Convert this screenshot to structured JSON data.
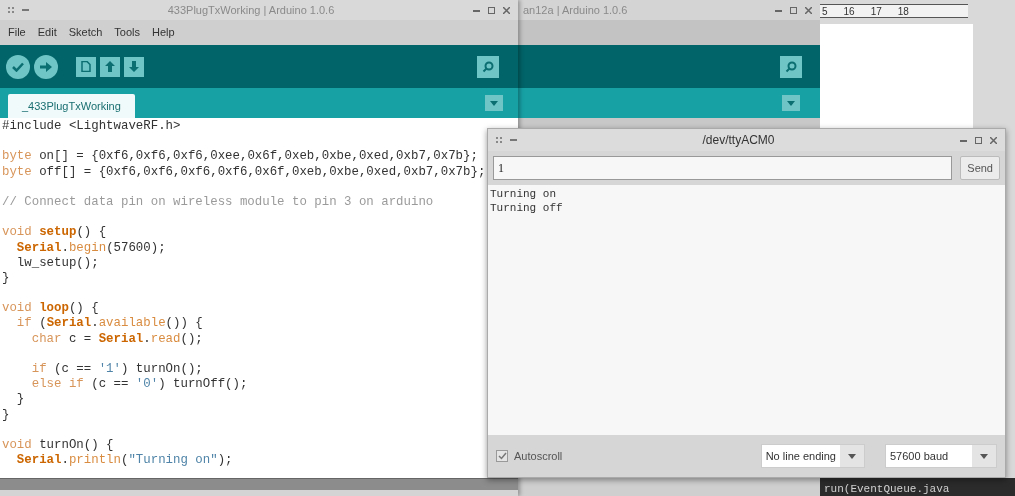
{
  "editor_window": {
    "title": "433PlugTxWorking | Arduino 1.0.6",
    "menu": [
      "File",
      "Edit",
      "Sketch",
      "Tools",
      "Help"
    ],
    "tabs": [
      {
        "label": "_433PlugTxWorking",
        "selected": true
      }
    ],
    "code": [
      {
        "kind": "code",
        "tokens": [
          {
            "kind": "plain",
            "text": "#include <LightwaveRF.h>"
          }
        ]
      },
      {
        "kind": "blank"
      },
      {
        "kind": "code",
        "tokens": [
          {
            "kind": "kw",
            "text": "byte"
          },
          {
            "kind": "plain",
            "text": " on[] = {0xf6,0xf6,0xf6,0xee,0x6f,0xeb,0xbe,0xed,0xb7,0x7b};"
          }
        ]
      },
      {
        "kind": "code",
        "tokens": [
          {
            "kind": "kw",
            "text": "byte"
          },
          {
            "kind": "plain",
            "text": " off[] = {0xf6,0xf6,0xf6,0xf6,0x6f,0xeb,0xbe,0xed,0xb7,0x7b};"
          }
        ]
      },
      {
        "kind": "blank"
      },
      {
        "kind": "code",
        "tokens": [
          {
            "kind": "comment",
            "text": "// Connect data pin on wireless module to pin 3 on arduino"
          }
        ]
      },
      {
        "kind": "blank"
      },
      {
        "kind": "code",
        "tokens": [
          {
            "kind": "kw",
            "text": "void"
          },
          {
            "kind": "fn",
            "text": " setup"
          },
          {
            "kind": "plain",
            "text": "() {"
          }
        ]
      },
      {
        "kind": "code",
        "tokens": [
          {
            "kind": "fn",
            "text": "  Serial"
          },
          {
            "kind": "plain",
            "text": "."
          },
          {
            "kind": "lib",
            "text": "begin"
          },
          {
            "kind": "plain",
            "text": "(57600);"
          }
        ]
      },
      {
        "kind": "code",
        "tokens": [
          {
            "kind": "plain",
            "text": "  lw_setup();"
          }
        ]
      },
      {
        "kind": "code",
        "tokens": [
          {
            "kind": "plain",
            "text": "}"
          }
        ]
      },
      {
        "kind": "blank"
      },
      {
        "kind": "code",
        "tokens": [
          {
            "kind": "kw",
            "text": "void"
          },
          {
            "kind": "fn",
            "text": " loop"
          },
          {
            "kind": "plain",
            "text": "() {"
          }
        ]
      },
      {
        "kind": "code",
        "tokens": [
          {
            "kind": "kw",
            "text": "  if"
          },
          {
            "kind": "plain",
            "text": " ("
          },
          {
            "kind": "fn",
            "text": "Serial"
          },
          {
            "kind": "plain",
            "text": "."
          },
          {
            "kind": "lib",
            "text": "available"
          },
          {
            "kind": "plain",
            "text": "()) {"
          }
        ]
      },
      {
        "kind": "code",
        "tokens": [
          {
            "kind": "kw",
            "text": "    char"
          },
          {
            "kind": "plain",
            "text": " c = "
          },
          {
            "kind": "fn",
            "text": "Serial"
          },
          {
            "kind": "plain",
            "text": "."
          },
          {
            "kind": "lib",
            "text": "read"
          },
          {
            "kind": "plain",
            "text": "();"
          }
        ]
      },
      {
        "kind": "blank"
      },
      {
        "kind": "code",
        "tokens": [
          {
            "kind": "kw",
            "text": "    if"
          },
          {
            "kind": "plain",
            "text": " (c == "
          },
          {
            "kind": "str",
            "text": "'1'"
          },
          {
            "kind": "plain",
            "text": ") turnOn();"
          }
        ]
      },
      {
        "kind": "code",
        "tokens": [
          {
            "kind": "kw",
            "text": "    else if"
          },
          {
            "kind": "plain",
            "text": " (c == "
          },
          {
            "kind": "str",
            "text": "'0'"
          },
          {
            "kind": "plain",
            "text": ") turnOff();"
          }
        ]
      },
      {
        "kind": "code",
        "tokens": [
          {
            "kind": "plain",
            "text": "  }"
          }
        ]
      },
      {
        "kind": "code",
        "tokens": [
          {
            "kind": "plain",
            "text": "}"
          }
        ]
      },
      {
        "kind": "blank"
      },
      {
        "kind": "code",
        "tokens": [
          {
            "kind": "kw",
            "text": "void"
          },
          {
            "kind": "plain",
            "text": " turnOn() {"
          }
        ]
      },
      {
        "kind": "code",
        "tokens": [
          {
            "kind": "fn",
            "text": "  Serial"
          },
          {
            "kind": "plain",
            "text": "."
          },
          {
            "kind": "lib",
            "text": "println"
          },
          {
            "kind": "plain",
            "text": "("
          },
          {
            "kind": "str",
            "text": "\"Turning on\""
          },
          {
            "kind": "plain",
            "text": ");"
          }
        ]
      }
    ]
  },
  "background_window": {
    "title": "an12a | Arduino 1.0.6"
  },
  "document_window": {
    "ruler": [
      "5",
      "16",
      "17",
      "18"
    ]
  },
  "console": {
    "lines": [
      "run(EventQueue.java"
    ]
  },
  "serial_monitor": {
    "title": "/dev/ttyACM0",
    "input": "1",
    "send": "Send",
    "output": [
      "Turning on",
      "Turning off"
    ],
    "autoscroll": {
      "label": "Autoscroll",
      "checked": true
    },
    "line_ending": "No line ending",
    "baud": "57600 baud"
  }
}
